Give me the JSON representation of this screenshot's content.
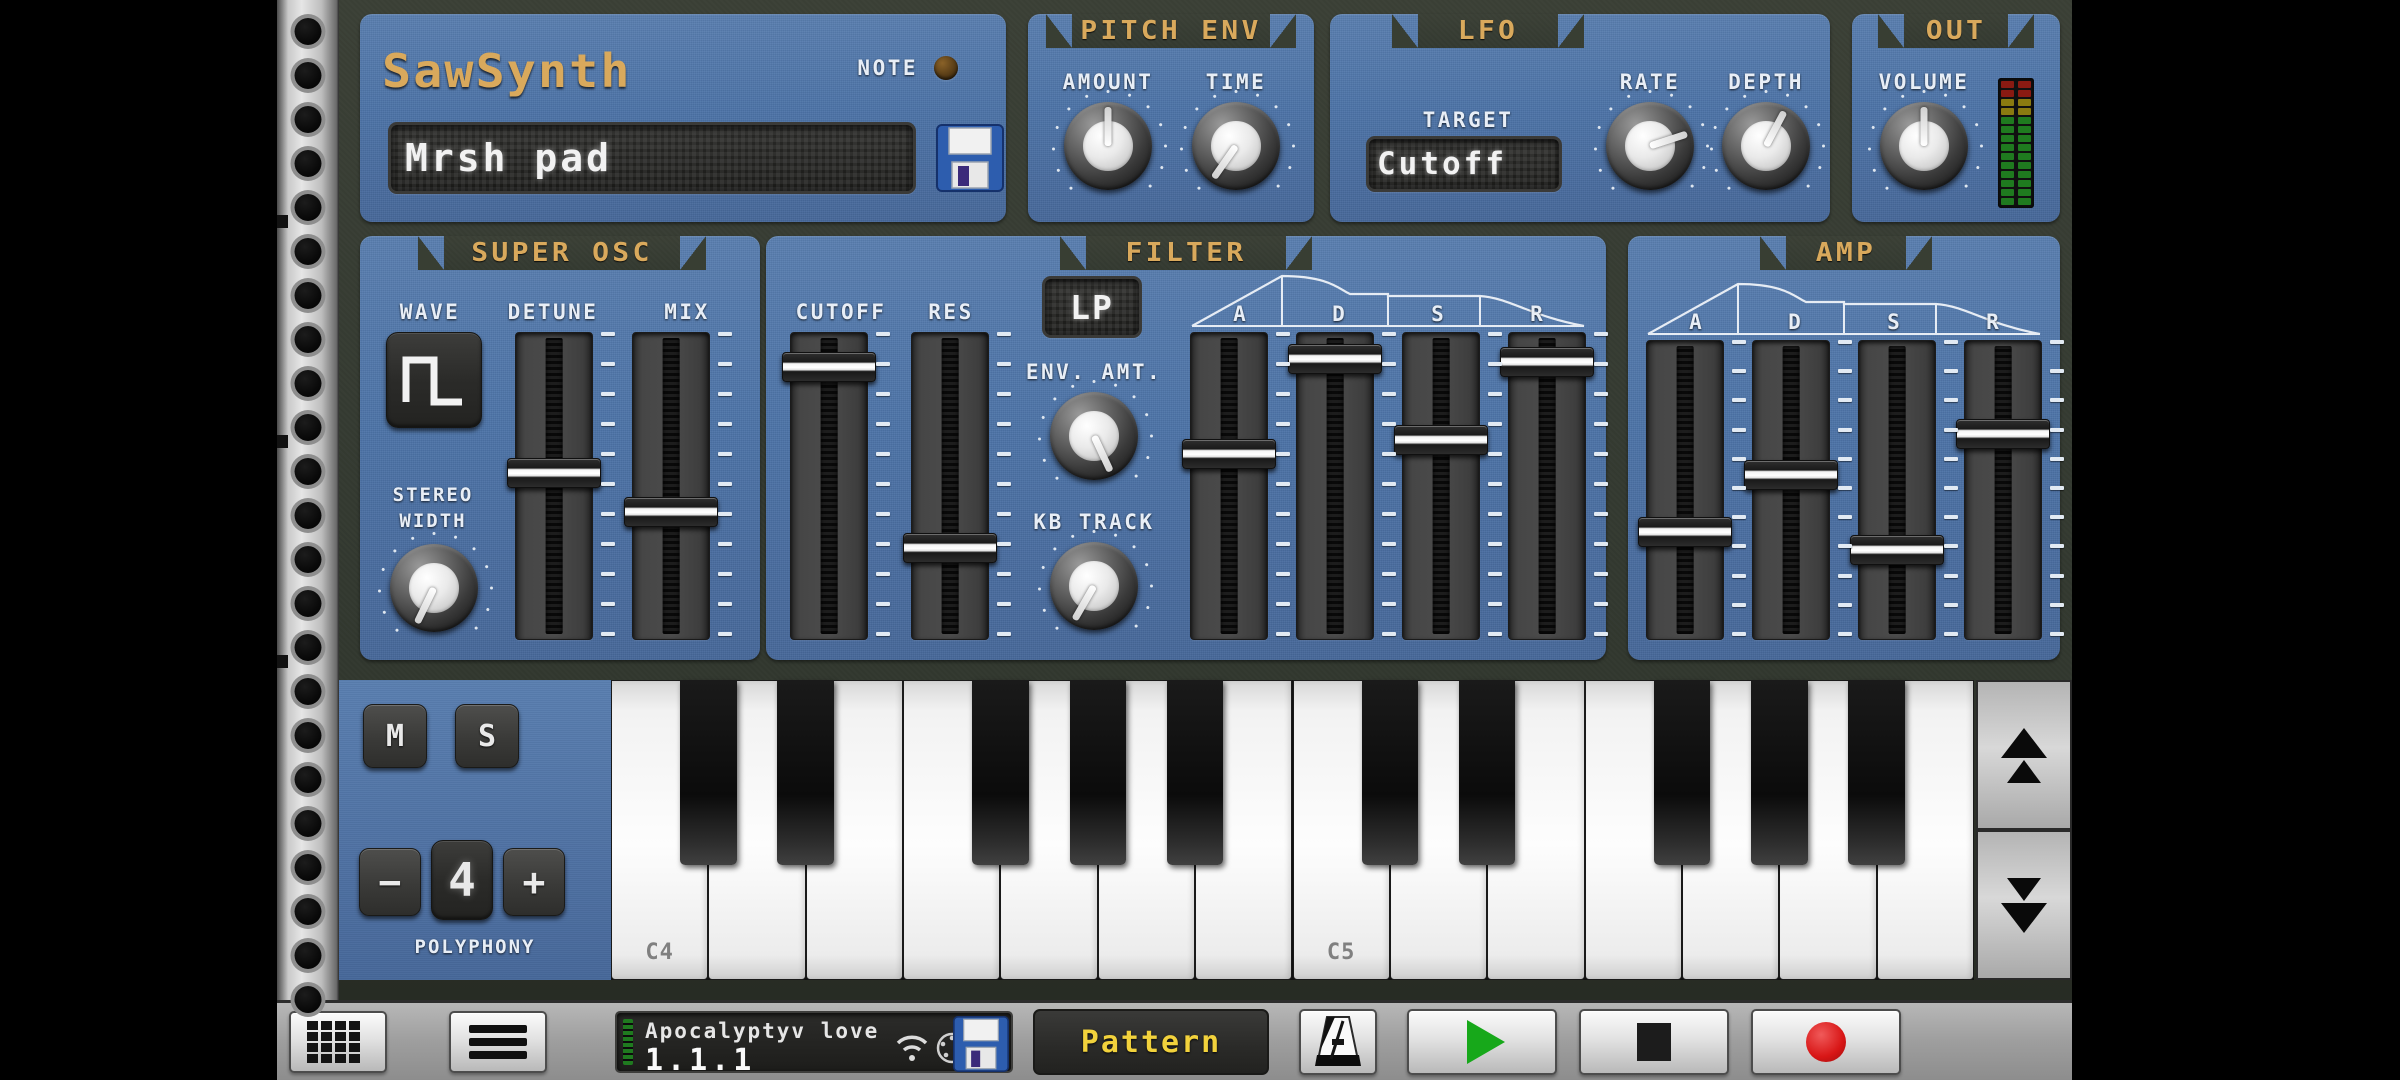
{
  "app": {
    "brand": "SawSynth",
    "preset_name": "Mrsh pad",
    "note_label": "NOTE",
    "note_led_color": "#6b4a1e",
    "panel_color": "#4d74a8",
    "title_color": "#d9a95c",
    "label_color": "#e8eef6"
  },
  "pitch_env": {
    "title": "PITCH ENV",
    "knobs": [
      {
        "label": "AMOUNT",
        "angle": 0,
        "value": 50
      },
      {
        "label": "TIME",
        "angle": -145,
        "value": 10
      }
    ]
  },
  "lfo": {
    "title": "LFO",
    "target_label": "TARGET",
    "target_value": "Cutoff",
    "knobs": [
      {
        "label": "RATE",
        "angle": 72,
        "value": 70
      },
      {
        "label": "DEPTH",
        "angle": 28,
        "value": 58
      }
    ]
  },
  "out": {
    "title": "OUT",
    "volume_label": "VOLUME",
    "volume_angle": 0,
    "volume_value": 50,
    "meter_segments": 14,
    "meter_colors": {
      "green": "#1f7a1f",
      "yellow": "#8a7a10",
      "red": "#8a1a12"
    }
  },
  "super_osc": {
    "title": "SUPER OSC",
    "wave_label": "WAVE",
    "wave_shape": "square-wave-icon",
    "sliders": [
      {
        "label": "DETUNE",
        "value": 55
      },
      {
        "label": "MIX",
        "value": 41
      }
    ],
    "stereo_width_label_1": "STEREO",
    "stereo_width_label_2": "WIDTH",
    "stereo_width_angle": -154,
    "stereo_width_value": 12
  },
  "filter": {
    "title": "FILTER",
    "mode_value": "LP",
    "sliders": [
      {
        "label": "CUTOFF",
        "value": 93
      },
      {
        "label": "RES",
        "value": 28
      }
    ],
    "knobs": [
      {
        "label": "ENV. AMT.",
        "angle": 155,
        "value": 78
      },
      {
        "label": "KB TRACK",
        "angle": -150,
        "value": 11
      }
    ],
    "adsr_labels": [
      "A",
      "D",
      "S",
      "R"
    ],
    "adsr": [
      62,
      96,
      67,
      95
    ]
  },
  "amp": {
    "title": "AMP",
    "adsr_labels": [
      "A",
      "D",
      "S",
      "R"
    ],
    "adsr": [
      35,
      56,
      28,
      71
    ]
  },
  "voice": {
    "mute_label": "M",
    "solo_label": "S",
    "minus_label": "−",
    "plus_label": "+",
    "polyphony_label": "POLYPHONY",
    "polyphony_value": "4"
  },
  "keyboard": {
    "octave_labels": [
      "C4",
      "C5"
    ],
    "octave_up_name": "octave-up-button",
    "octave_down_name": "octave-down-button"
  },
  "transport": {
    "grid_button": "grid-icon",
    "menu_button": "menu-icon",
    "song_name": "Apocalyptyv love",
    "song_position": "1.1.1",
    "wifi_icon": "wifi-icon",
    "midi_icon": "midi-din-icon",
    "save_icon": "save-icon",
    "pattern_label": "Pattern",
    "metronome_icon": "metronome-icon",
    "play_icon": "play-icon",
    "stop_icon": "stop-icon",
    "record_icon": "record-icon",
    "play_color": "#17a81a",
    "stop_color": "#1c1c1c",
    "record_color": "#d81616"
  }
}
